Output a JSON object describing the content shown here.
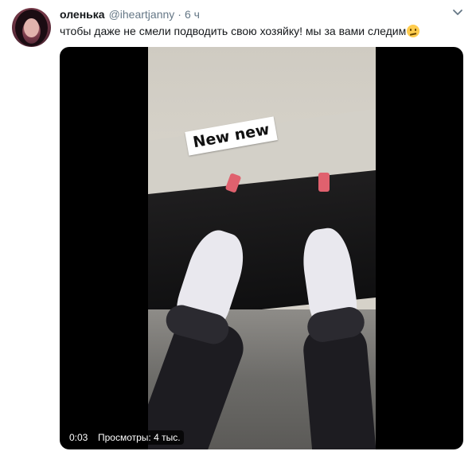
{
  "tweet": {
    "author": {
      "name": "оленька",
      "handle": "@iheartjanny",
      "separator": "·",
      "time": "6 ч"
    },
    "text": "чтобы даже не смели подводить свою хозяйку! мы за вами следим",
    "emoji": "face-with-raised-eyebrow-emoji",
    "media": {
      "sticker_text": "New new",
      "duration": "0:03",
      "views": "Просмотры: 4 тыс."
    }
  },
  "icons": {
    "caret": "chevron-down-icon"
  },
  "colors": {
    "text": "#14171a",
    "secondary": "#657786",
    "media_bg": "#000000"
  }
}
